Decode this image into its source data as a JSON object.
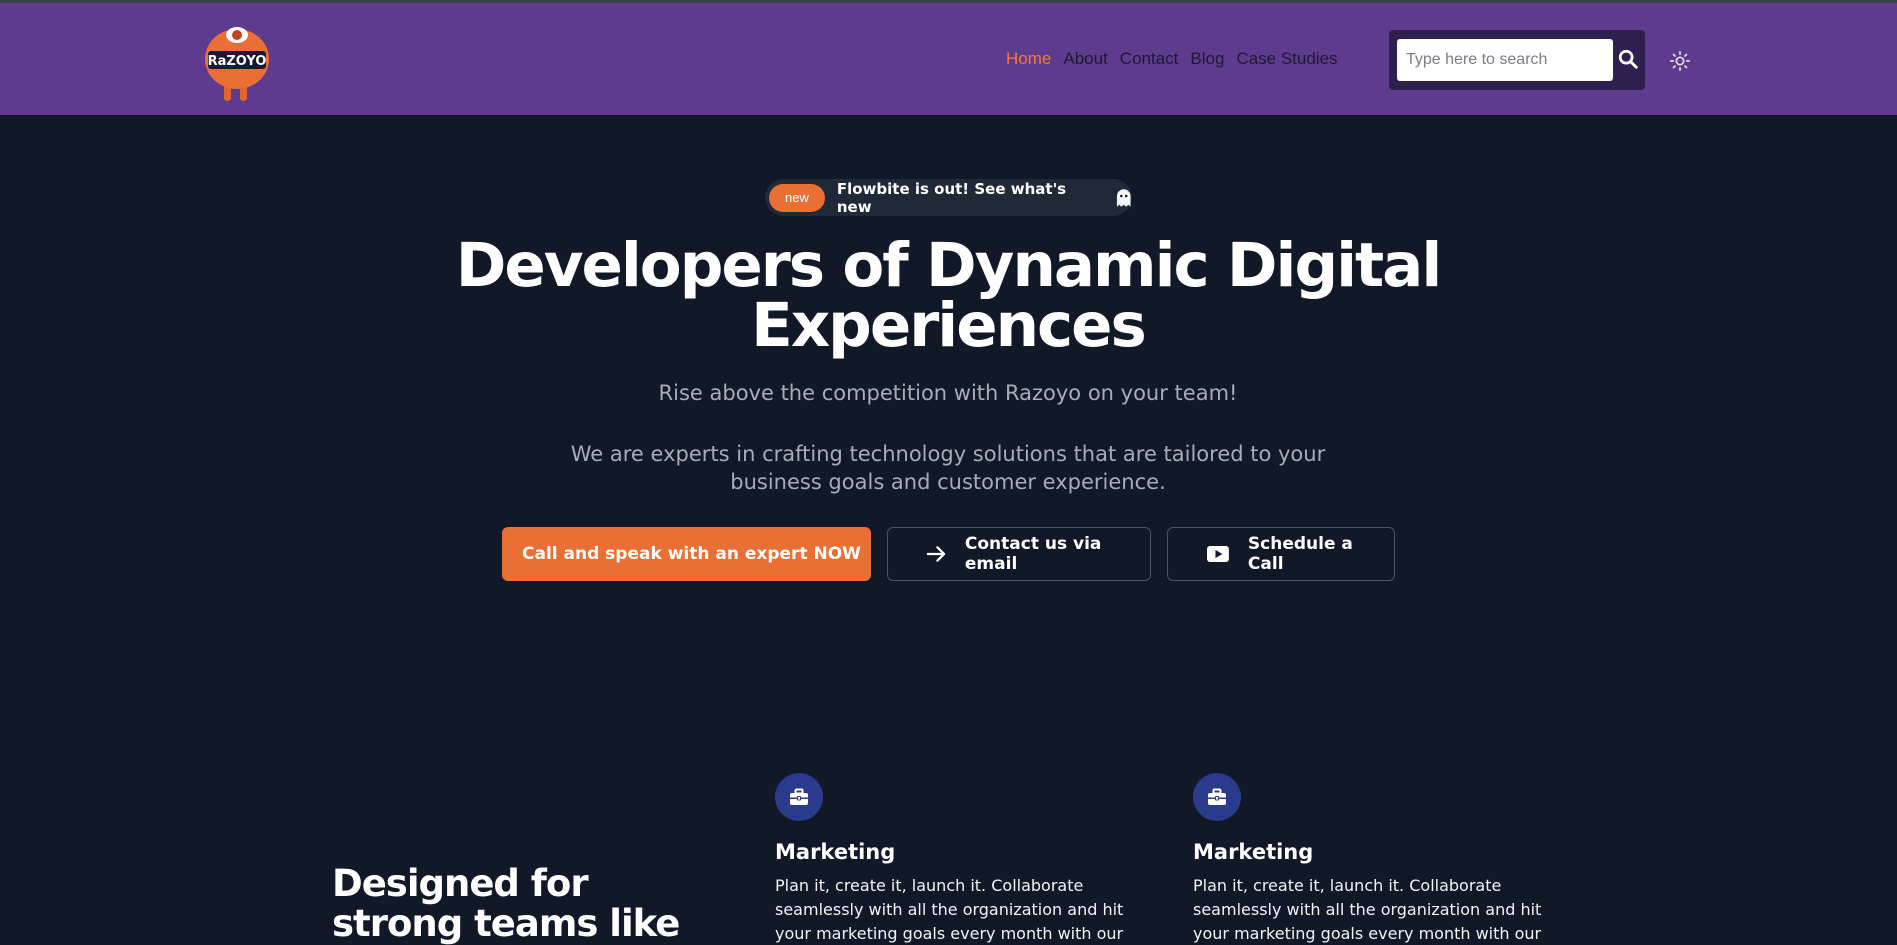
{
  "header": {
    "nav": [
      {
        "label": "Home",
        "active": true
      },
      {
        "label": "About"
      },
      {
        "label": "Contact"
      },
      {
        "label": "Blog"
      },
      {
        "label": "Case Studies"
      }
    ],
    "search": {
      "placeholder": "Type here to search"
    },
    "logo_text": "RaZOYO",
    "colors": {
      "header_bg": "#5f3b8f",
      "accent": "#e96f35",
      "page_bg": "#111827"
    }
  },
  "hero": {
    "badge_tag": "new",
    "badge_text": "Flowbite is out! See what's new",
    "title_line1": "Developers of Dynamic Digital",
    "title_line2": "Experiences",
    "subtitle": "Rise above the competition with Razoyo on your team!",
    "description_line1": "We are experts in crafting technology solutions that are tailored to your",
    "description_line2": "business goals and customer experience.",
    "buttons": {
      "primary": "Call and speak with an expert NOW",
      "email": "Contact us via email",
      "schedule": "Schedule a Call"
    }
  },
  "features": {
    "heading_line1": "Designed for",
    "heading_line2": "strong teams like",
    "items": [
      {
        "icon": "briefcase-icon",
        "title": "Marketing",
        "text": "Plan it, create it, launch it. Collaborate seamlessly with all the organization and hit your marketing goals every month with our"
      },
      {
        "icon": "briefcase-icon",
        "title": "Marketing",
        "text": "Plan it, create it, launch it. Collaborate seamlessly with all the organization and hit your marketing goals every month with our"
      }
    ]
  }
}
